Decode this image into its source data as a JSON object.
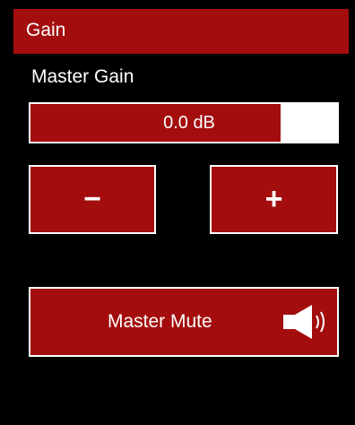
{
  "header": {
    "title": "Gain"
  },
  "master_gain": {
    "label": "Master Gain",
    "value_text": "0.0 dB",
    "level_fraction": 0.81
  },
  "buttons": {
    "decrease_label": "−",
    "increase_label": "+",
    "mute_label": "Master Mute",
    "mute_icon": "speaker-volume-icon"
  },
  "colors": {
    "accent": "#a30d0d",
    "background": "#000000",
    "text": "#ffffff",
    "meter_empty": "#ffffff"
  }
}
